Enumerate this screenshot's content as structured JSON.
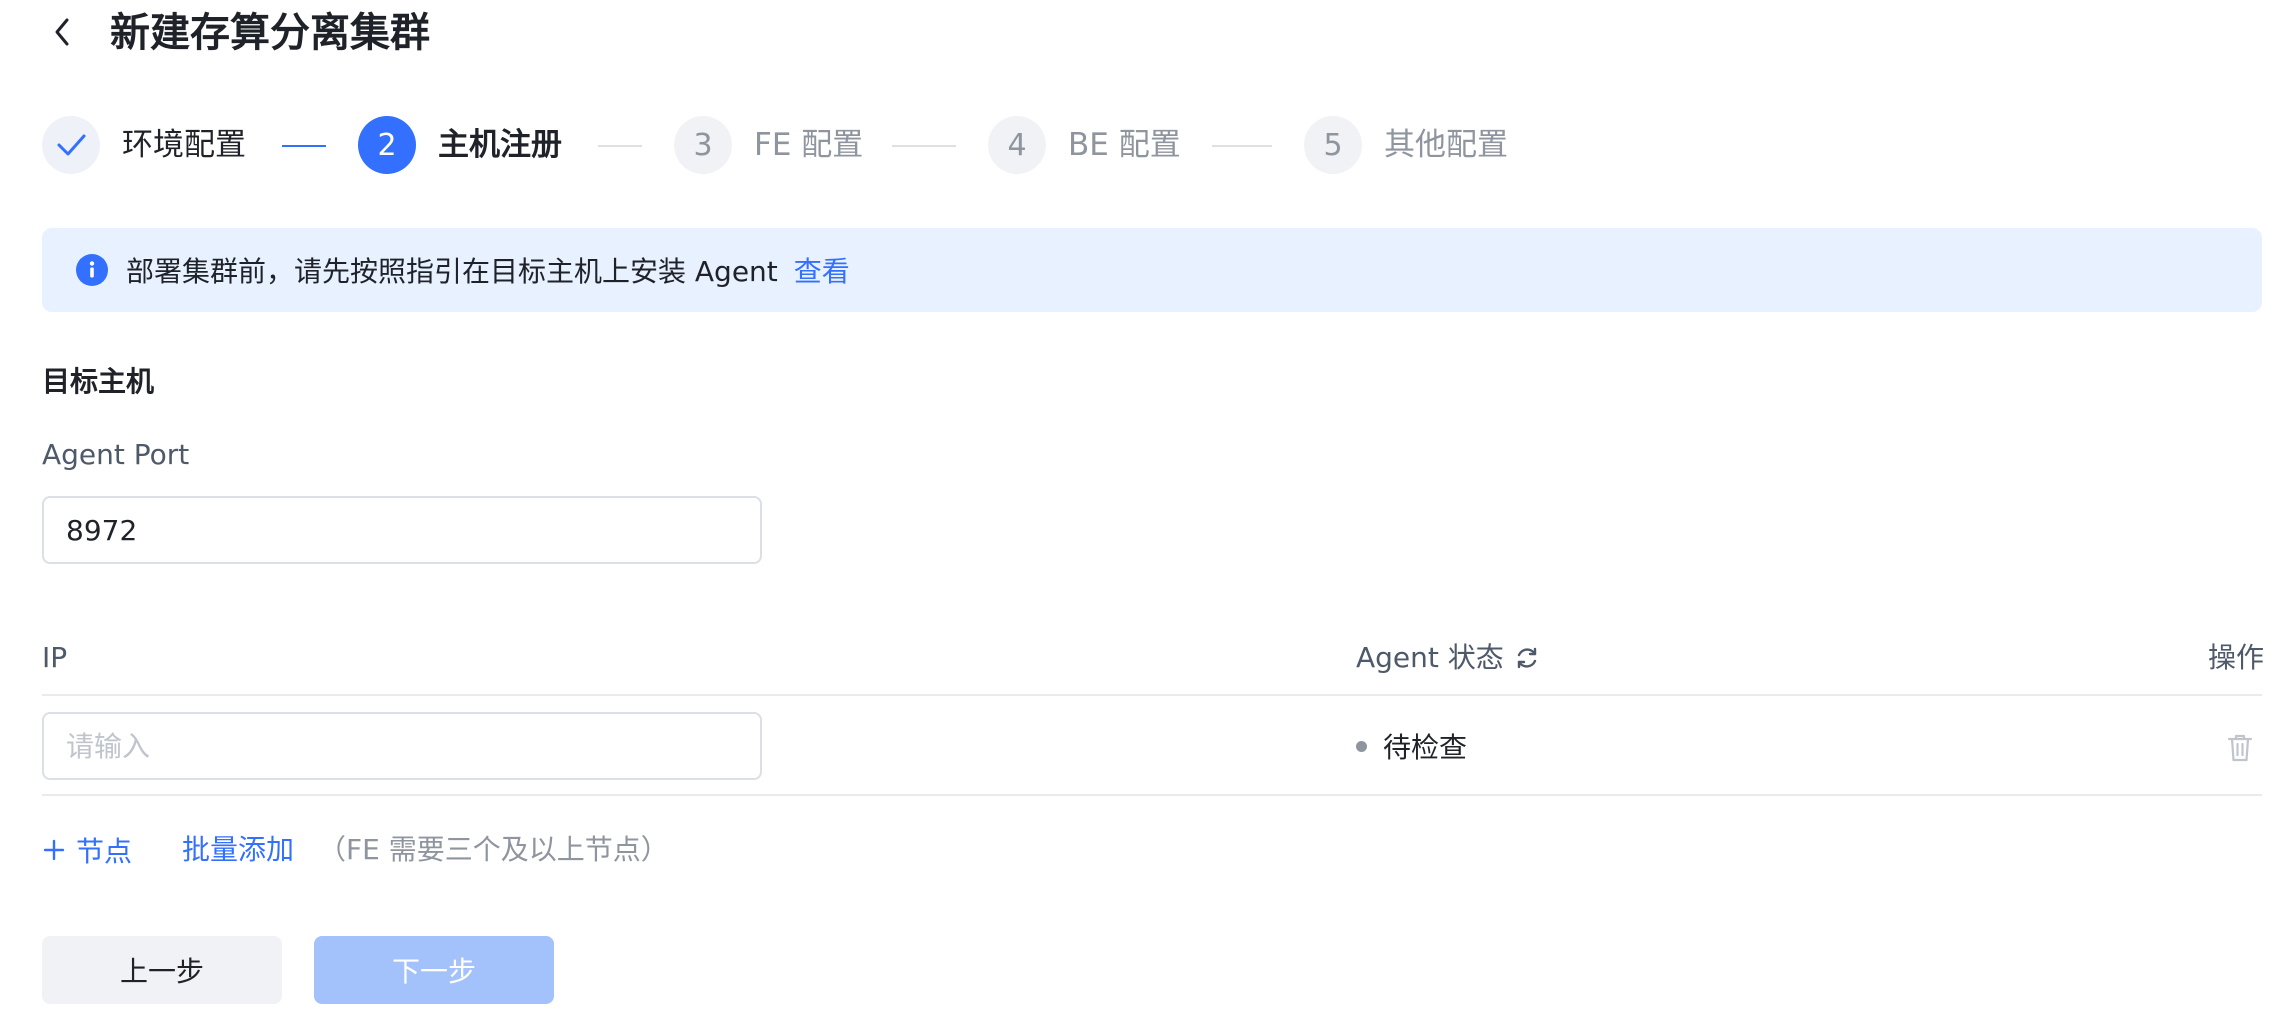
{
  "header": {
    "title": "新建存算分离集群"
  },
  "steps": [
    {
      "number": "",
      "label": "环境配置",
      "state": "done"
    },
    {
      "number": "2",
      "label": "主机注册",
      "state": "active"
    },
    {
      "number": "3",
      "label": "FE 配置",
      "state": "pending"
    },
    {
      "number": "4",
      "label": "BE 配置",
      "state": "pending"
    },
    {
      "number": "5",
      "label": "其他配置",
      "state": "pending"
    }
  ],
  "alert": {
    "text": "部署集群前，请先按照指引在目标主机上安装 Agent",
    "link": "查看"
  },
  "section": {
    "title": "目标主机"
  },
  "agent_port": {
    "label": "Agent Port",
    "value": "8972"
  },
  "table": {
    "columns": {
      "ip": "IP",
      "status": "Agent 状态",
      "action": "操作"
    },
    "rows": [
      {
        "ip_value": "",
        "ip_placeholder": "请输入",
        "status": "待检查"
      }
    ]
  },
  "actions": {
    "add_node": "节点",
    "batch_add": "批量添加",
    "hint": "（FE 需要三个及以上节点）"
  },
  "buttons": {
    "prev": "上一步",
    "next": "下一步"
  },
  "colors": {
    "primary": "#3370ff",
    "primary_disabled": "#a3c2fb",
    "alert_bg": "#e8f1ff",
    "muted": "#8f959e"
  },
  "icons": {
    "back": "chevron-left-icon",
    "step_done": "check-icon",
    "alert": "info-icon",
    "refresh": "refresh-icon",
    "delete": "trash-icon",
    "add": "plus-icon"
  }
}
